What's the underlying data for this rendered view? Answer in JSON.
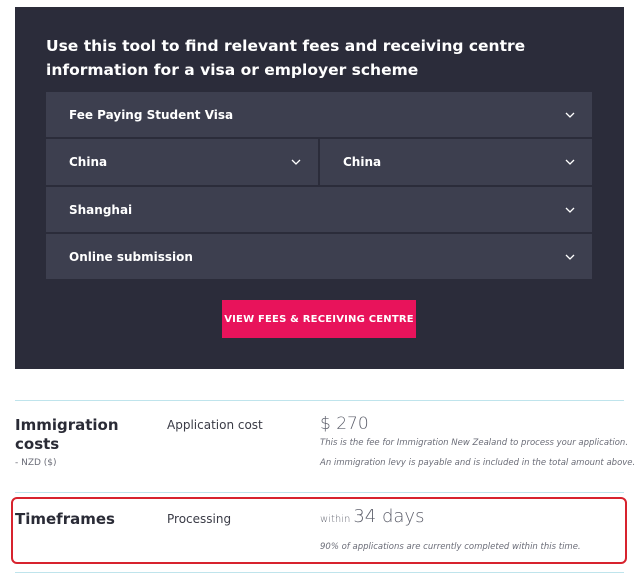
{
  "tool": {
    "heading": "Use this tool to find relevant fees and receiving centre information for a visa or employer scheme",
    "visa_select": "Fee Paying Student Visa",
    "country_select": "China",
    "location_select": "China",
    "city_select": "Shanghai",
    "method_select": "Online submission",
    "cta_label": "VIEW FEES & RECEIVING CENTRE"
  },
  "costs": {
    "title": "Immigration costs",
    "subtitle": "- NZD ($)",
    "row_label": "Application cost",
    "amount": "$ 270",
    "note1": "This is the fee for Immigration New Zealand to process your application.",
    "note2": "An immigration levy is payable and is included in the total amount above."
  },
  "timeframes": {
    "title": "Timeframes",
    "row_label": "Processing",
    "within": "within",
    "days": "34 days",
    "note": "90% of applications are currently completed within this time."
  },
  "colors": {
    "panel_bg": "#2b2c3a",
    "select_bg": "#3d3f4f",
    "cta_bg": "#e8135b",
    "rule": "#bfe4ec",
    "highlight": "#d7232e"
  },
  "icons": {
    "select_chevron": "chevron-down-icon"
  }
}
